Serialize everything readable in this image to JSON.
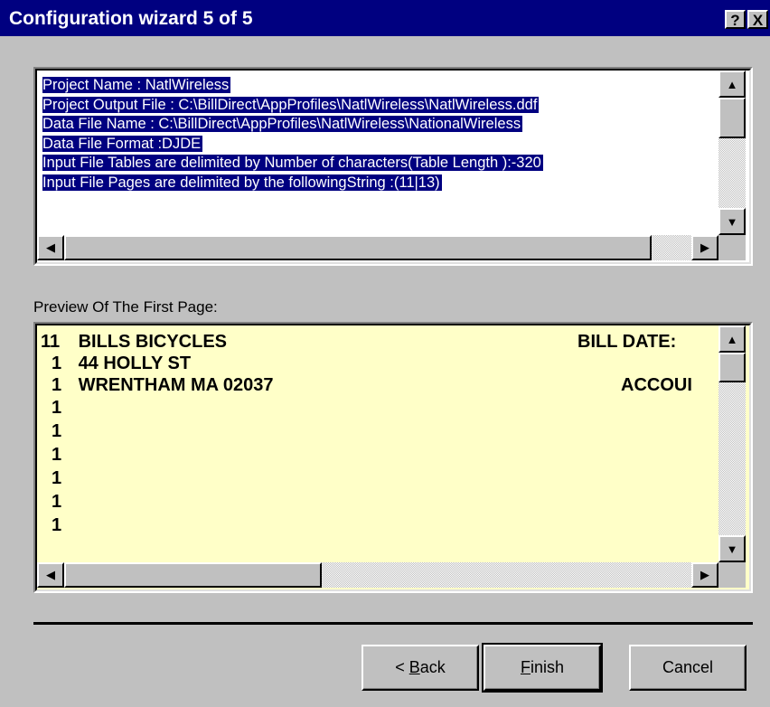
{
  "window": {
    "title": "Configuration wizard 5 of 5",
    "help_label": "?",
    "close_label": "X"
  },
  "info": {
    "lines": [
      "Project Name        :  NatlWireless",
      "Project Output File  :   C:\\BillDirect\\AppProfiles\\NatlWireless\\NatlWireless.ddf",
      "Data File Name      :   C:\\BillDirect\\AppProfiles\\NatlWireless\\NationalWireless",
      "Data File Format     :DJDE",
      "Input File Tables are delimited by Number of characters(Table Length ):-320",
      "Input File Pages are delimited by the followingString  :(11|13)"
    ]
  },
  "preview": {
    "label": "Preview Of The First Page:",
    "lines": [
      {
        "code": "11",
        "text": "BILLS BICYCLES",
        "right": "BILL DATE:"
      },
      {
        "code": "1",
        "text": "44 HOLLY ST",
        "right": ""
      },
      {
        "code": "1",
        "text": "WRENTHAM MA 02037",
        "right": "ACCOUI"
      },
      {
        "code": "1",
        "text": "",
        "right": ""
      },
      {
        "code": "1",
        "text": "",
        "right": ""
      },
      {
        "code": "1",
        "text": "",
        "right": ""
      },
      {
        "code": "1",
        "text": "",
        "right": ""
      },
      {
        "code": "1",
        "text": "",
        "right": ""
      },
      {
        "code": "1",
        "text": "",
        "right": ""
      }
    ]
  },
  "buttons": {
    "back_prefix": "< ",
    "back_accel": "B",
    "back_rest": "ack",
    "finish_accel": "F",
    "finish_rest": "inish",
    "cancel": "Cancel"
  },
  "icons": {
    "up": "▲",
    "down": "▼",
    "left": "◀",
    "right": "▶"
  }
}
